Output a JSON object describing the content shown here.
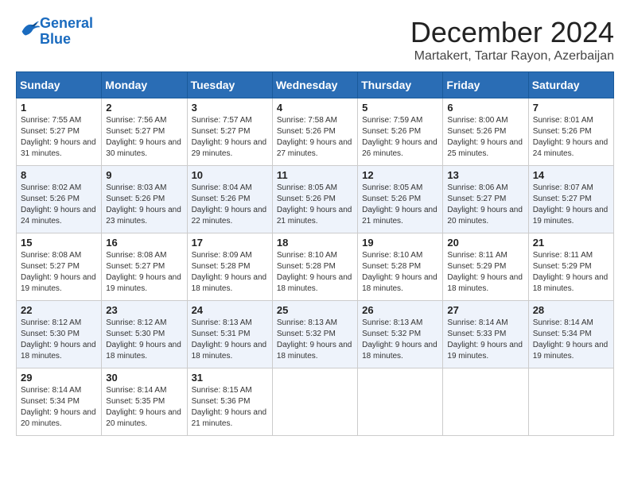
{
  "logo": {
    "text_general": "General",
    "text_blue": "Blue"
  },
  "header": {
    "month_year": "December 2024",
    "location": "Martakert, Tartar Rayon, Azerbaijan"
  },
  "weekdays": [
    "Sunday",
    "Monday",
    "Tuesday",
    "Wednesday",
    "Thursday",
    "Friday",
    "Saturday"
  ],
  "weeks": [
    [
      {
        "day": "1",
        "sunrise": "7:55 AM",
        "sunset": "5:27 PM",
        "daylight": "9 hours and 31 minutes."
      },
      {
        "day": "2",
        "sunrise": "7:56 AM",
        "sunset": "5:27 PM",
        "daylight": "9 hours and 30 minutes."
      },
      {
        "day": "3",
        "sunrise": "7:57 AM",
        "sunset": "5:27 PM",
        "daylight": "9 hours and 29 minutes."
      },
      {
        "day": "4",
        "sunrise": "7:58 AM",
        "sunset": "5:26 PM",
        "daylight": "9 hours and 27 minutes."
      },
      {
        "day": "5",
        "sunrise": "7:59 AM",
        "sunset": "5:26 PM",
        "daylight": "9 hours and 26 minutes."
      },
      {
        "day": "6",
        "sunrise": "8:00 AM",
        "sunset": "5:26 PM",
        "daylight": "9 hours and 25 minutes."
      },
      {
        "day": "7",
        "sunrise": "8:01 AM",
        "sunset": "5:26 PM",
        "daylight": "9 hours and 24 minutes."
      }
    ],
    [
      {
        "day": "8",
        "sunrise": "8:02 AM",
        "sunset": "5:26 PM",
        "daylight": "9 hours and 24 minutes."
      },
      {
        "day": "9",
        "sunrise": "8:03 AM",
        "sunset": "5:26 PM",
        "daylight": "9 hours and 23 minutes."
      },
      {
        "day": "10",
        "sunrise": "8:04 AM",
        "sunset": "5:26 PM",
        "daylight": "9 hours and 22 minutes."
      },
      {
        "day": "11",
        "sunrise": "8:05 AM",
        "sunset": "5:26 PM",
        "daylight": "9 hours and 21 minutes."
      },
      {
        "day": "12",
        "sunrise": "8:05 AM",
        "sunset": "5:26 PM",
        "daylight": "9 hours and 21 minutes."
      },
      {
        "day": "13",
        "sunrise": "8:06 AM",
        "sunset": "5:27 PM",
        "daylight": "9 hours and 20 minutes."
      },
      {
        "day": "14",
        "sunrise": "8:07 AM",
        "sunset": "5:27 PM",
        "daylight": "9 hours and 19 minutes."
      }
    ],
    [
      {
        "day": "15",
        "sunrise": "8:08 AM",
        "sunset": "5:27 PM",
        "daylight": "9 hours and 19 minutes."
      },
      {
        "day": "16",
        "sunrise": "8:08 AM",
        "sunset": "5:27 PM",
        "daylight": "9 hours and 19 minutes."
      },
      {
        "day": "17",
        "sunrise": "8:09 AM",
        "sunset": "5:28 PM",
        "daylight": "9 hours and 18 minutes."
      },
      {
        "day": "18",
        "sunrise": "8:10 AM",
        "sunset": "5:28 PM",
        "daylight": "9 hours and 18 minutes."
      },
      {
        "day": "19",
        "sunrise": "8:10 AM",
        "sunset": "5:28 PM",
        "daylight": "9 hours and 18 minutes."
      },
      {
        "day": "20",
        "sunrise": "8:11 AM",
        "sunset": "5:29 PM",
        "daylight": "9 hours and 18 minutes."
      },
      {
        "day": "21",
        "sunrise": "8:11 AM",
        "sunset": "5:29 PM",
        "daylight": "9 hours and 18 minutes."
      }
    ],
    [
      {
        "day": "22",
        "sunrise": "8:12 AM",
        "sunset": "5:30 PM",
        "daylight": "9 hours and 18 minutes."
      },
      {
        "day": "23",
        "sunrise": "8:12 AM",
        "sunset": "5:30 PM",
        "daylight": "9 hours and 18 minutes."
      },
      {
        "day": "24",
        "sunrise": "8:13 AM",
        "sunset": "5:31 PM",
        "daylight": "9 hours and 18 minutes."
      },
      {
        "day": "25",
        "sunrise": "8:13 AM",
        "sunset": "5:32 PM",
        "daylight": "9 hours and 18 minutes."
      },
      {
        "day": "26",
        "sunrise": "8:13 AM",
        "sunset": "5:32 PM",
        "daylight": "9 hours and 18 minutes."
      },
      {
        "day": "27",
        "sunrise": "8:14 AM",
        "sunset": "5:33 PM",
        "daylight": "9 hours and 19 minutes."
      },
      {
        "day": "28",
        "sunrise": "8:14 AM",
        "sunset": "5:34 PM",
        "daylight": "9 hours and 19 minutes."
      }
    ],
    [
      {
        "day": "29",
        "sunrise": "8:14 AM",
        "sunset": "5:34 PM",
        "daylight": "9 hours and 20 minutes."
      },
      {
        "day": "30",
        "sunrise": "8:14 AM",
        "sunset": "5:35 PM",
        "daylight": "9 hours and 20 minutes."
      },
      {
        "day": "31",
        "sunrise": "8:15 AM",
        "sunset": "5:36 PM",
        "daylight": "9 hours and 21 minutes."
      },
      null,
      null,
      null,
      null
    ]
  ]
}
